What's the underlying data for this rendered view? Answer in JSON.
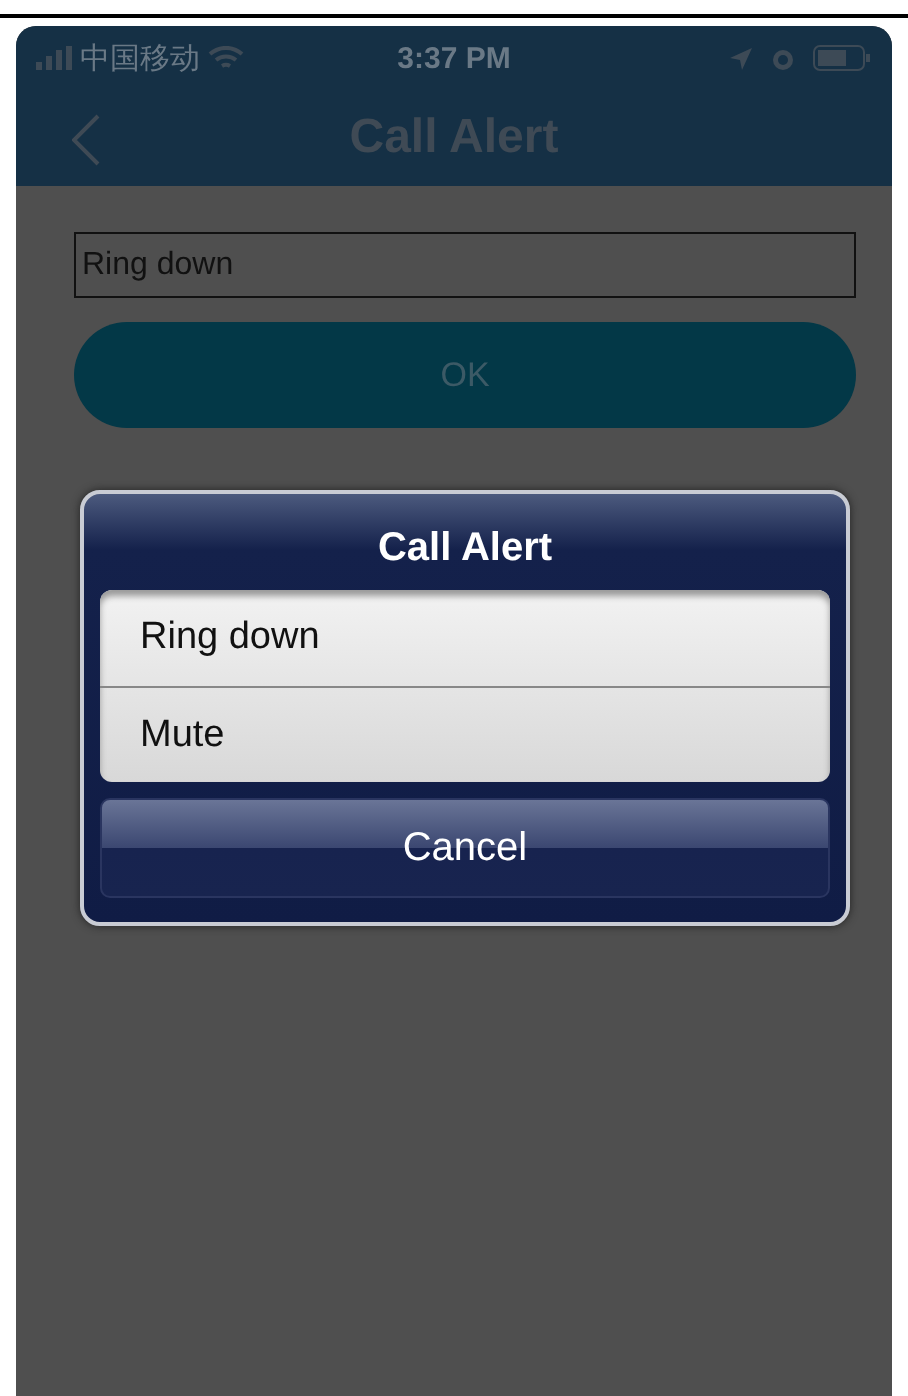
{
  "status_bar": {
    "carrier": "中国移动",
    "time": "3:37 PM"
  },
  "nav_bar": {
    "title": "Call Alert"
  },
  "field": {
    "value": "Ring down"
  },
  "ok_button": {
    "label": "OK"
  },
  "dialog": {
    "title": "Call Alert",
    "options": [
      {
        "label": "Ring down"
      },
      {
        "label": "Mute"
      }
    ],
    "cancel": "Cancel"
  }
}
